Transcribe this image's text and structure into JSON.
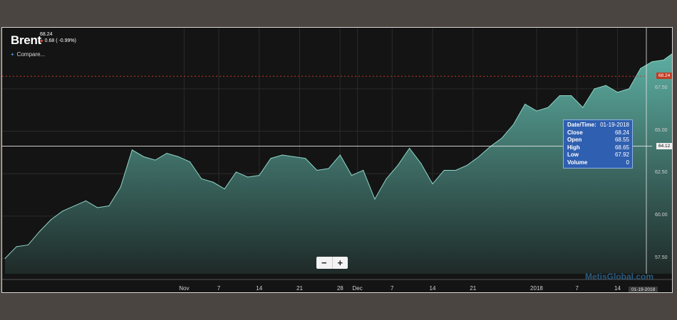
{
  "header": {
    "title": "Brent",
    "last_price": "68.24",
    "change": "0.68 ( -0.99%)",
    "compare_label": "Compare..."
  },
  "tooltip": {
    "rows": [
      {
        "key": "Date/Time:",
        "value": "01-19-2018"
      },
      {
        "key": "Close",
        "value": "68.24"
      },
      {
        "key": "Open",
        "value": "68.55"
      },
      {
        "key": "High",
        "value": "68.65"
      },
      {
        "key": "Low",
        "value": "67.92"
      },
      {
        "key": "Volume",
        "value": "0"
      }
    ]
  },
  "flags": {
    "last_price": "68.24",
    "crosshair_price": "64.12",
    "crosshair_date": "01-19-2018"
  },
  "watermark": "MetisGlobal.com",
  "zoom": {
    "minus": "−",
    "plus": "+"
  },
  "colors": {
    "background": "#141414",
    "area_top": "#5fb3a6",
    "area_bottom": "#1e2a28",
    "last_line": "#c23b23",
    "tooltip_bg": "#2f5fb0"
  },
  "chart_data": {
    "type": "area",
    "y_ticks": [
      "67.50",
      "65.00",
      "62.50",
      "60.00",
      "57.50"
    ],
    "y_tick_values": [
      67.5,
      65.0,
      62.5,
      60.0,
      57.5
    ],
    "ylim": [
      56.6,
      71.1
    ],
    "grid": true,
    "x_ticks": [
      "Nov",
      "7",
      "14",
      "21",
      "28",
      "Dec",
      "7",
      "14",
      "21",
      "2018",
      "7",
      "14"
    ],
    "x_tick_values": [
      31,
      37,
      44,
      51,
      58,
      61,
      67,
      74,
      81,
      92,
      99,
      106
    ],
    "x_range": [
      0,
      111
    ],
    "series": [
      {
        "values": [
          [
            0,
            57.5
          ],
          [
            2,
            58.2
          ],
          [
            4,
            58.3
          ],
          [
            6,
            59.1
          ],
          [
            8,
            59.8
          ],
          [
            10,
            60.3
          ],
          [
            12,
            60.6
          ],
          [
            14,
            60.9
          ],
          [
            16,
            60.5
          ],
          [
            18,
            60.6
          ],
          [
            20,
            61.7
          ],
          [
            22,
            63.9
          ],
          [
            24,
            63.5
          ],
          [
            26,
            63.3
          ],
          [
            28,
            63.7
          ],
          [
            30,
            63.5
          ],
          [
            32,
            63.2
          ],
          [
            34,
            62.2
          ],
          [
            36,
            62.0
          ],
          [
            38,
            61.6
          ],
          [
            40,
            62.6
          ],
          [
            42,
            62.3
          ],
          [
            44,
            62.4
          ],
          [
            46,
            63.4
          ],
          [
            48,
            63.6
          ],
          [
            50,
            63.5
          ],
          [
            52,
            63.4
          ],
          [
            54,
            62.7
          ],
          [
            56,
            62.8
          ],
          [
            58,
            63.6
          ],
          [
            60,
            62.4
          ],
          [
            62,
            62.7
          ],
          [
            64,
            61.0
          ],
          [
            66,
            62.2
          ],
          [
            68,
            63.0
          ],
          [
            70,
            64.0
          ],
          [
            72,
            63.1
          ],
          [
            74,
            61.9
          ],
          [
            76,
            62.7
          ],
          [
            78,
            62.7
          ],
          [
            80,
            63.0
          ],
          [
            82,
            63.5
          ],
          [
            84,
            64.1
          ],
          [
            86,
            64.6
          ],
          [
            88,
            65.4
          ],
          [
            90,
            66.6
          ],
          [
            92,
            66.2
          ],
          [
            94,
            66.4
          ],
          [
            96,
            67.1
          ],
          [
            98,
            67.1
          ],
          [
            100,
            66.4
          ],
          [
            102,
            67.5
          ],
          [
            104,
            67.7
          ],
          [
            106,
            67.3
          ],
          [
            108,
            67.5
          ],
          [
            110,
            68.7
          ],
          [
            112,
            69.1
          ],
          [
            114,
            69.2
          ],
          [
            116,
            69.7
          ],
          [
            118,
            70.1
          ],
          [
            120,
            69.2
          ],
          [
            122,
            69.5
          ],
          [
            124,
            69.4
          ],
          [
            126,
            68.8
          ]
        ]
      }
    ],
    "last_value": 68.24,
    "crosshair_value": 64.12
  }
}
